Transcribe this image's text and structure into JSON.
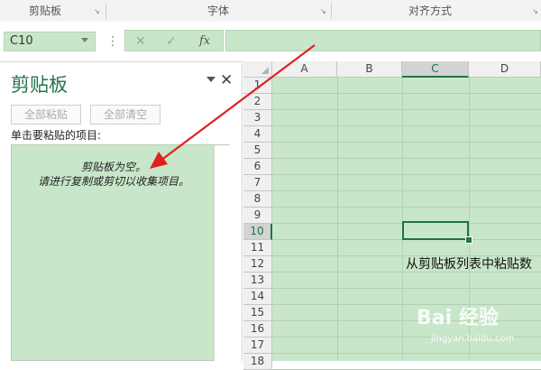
{
  "ribbon": {
    "groups": [
      "剪贴板",
      "字体",
      "对齐方式"
    ]
  },
  "formula_bar": {
    "name_box": "C10",
    "cancel_icon": "✕",
    "enter_icon": "✓",
    "fx_label": "fx",
    "more_icon": "⋮"
  },
  "clipboard_pane": {
    "title": "剪贴板",
    "menu_icon": "chevron-down-icon",
    "close_icon": "✕",
    "paste_all": "全部粘贴",
    "clear_all": "全部清空",
    "list_label": "单击要粘贴的项目:",
    "empty_line1": "剪贴板为空。",
    "empty_line2": "请进行复制或剪切以收集项目。"
  },
  "sheet": {
    "columns": [
      "A",
      "B",
      "C",
      "D"
    ],
    "selected_column": "C",
    "rows": [
      "1",
      "2",
      "3",
      "4",
      "5",
      "6",
      "7",
      "8",
      "9",
      "10",
      "11",
      "12",
      "13",
      "14",
      "15",
      "16",
      "17",
      "18"
    ],
    "selected_row": "10",
    "annotation_text": "从剪贴板列表中粘贴数"
  },
  "watermark": {
    "text": "Bai 经验",
    "sub": "jingyan.baidu.com"
  },
  "colors": {
    "accent": "#217346",
    "highlight": "#c8e6c9",
    "arrow": "#e02020"
  }
}
